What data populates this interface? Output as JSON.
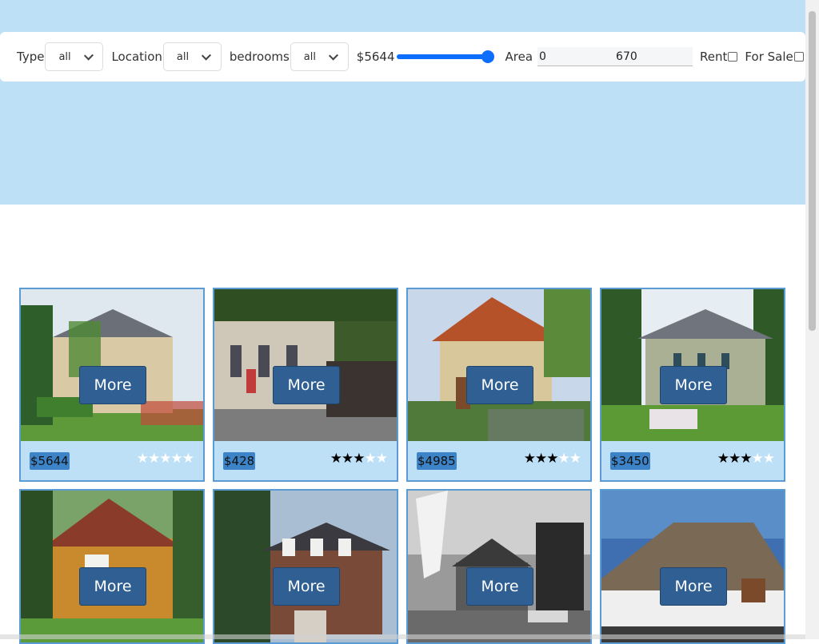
{
  "filters": {
    "type_label": "Type",
    "type_value": "all",
    "location_label": "Location",
    "location_value": "all",
    "bedrooms_label": "bedrooms",
    "bedrooms_value": "all",
    "price_value": "$5644",
    "price_slider_fraction": 1.0,
    "area_label": "Area",
    "area_min": "0",
    "area_max": "670",
    "rent_label": "Rent",
    "for_sale_label": "For Sale"
  },
  "cards": [
    {
      "price": "$5644",
      "rating": 0,
      "more_label": "More",
      "photo": "mansion"
    },
    {
      "price": "$428",
      "rating": 3,
      "more_label": "More",
      "photo": "street-villa"
    },
    {
      "price": "$4985",
      "rating": 3,
      "more_label": "More",
      "photo": "tiled-villa"
    },
    {
      "price": "$3450",
      "rating": 3,
      "more_label": "More",
      "photo": "colonial"
    },
    {
      "price": "",
      "rating": 0,
      "more_label": "More",
      "photo": "wood-house"
    },
    {
      "price": "",
      "rating": 0,
      "more_label": "More",
      "photo": "brick-house"
    },
    {
      "price": "",
      "rating": 0,
      "more_label": "More",
      "photo": "bw-house"
    },
    {
      "price": "",
      "rating": 0,
      "more_label": "More",
      "photo": "thatched"
    }
  ],
  "colors": {
    "hero_bg": "#bde0f7",
    "card_border": "#5a9bd3",
    "button_bg": "#2f5f93",
    "price_badge": "#3c83c8",
    "slider": "#0d6efd"
  }
}
